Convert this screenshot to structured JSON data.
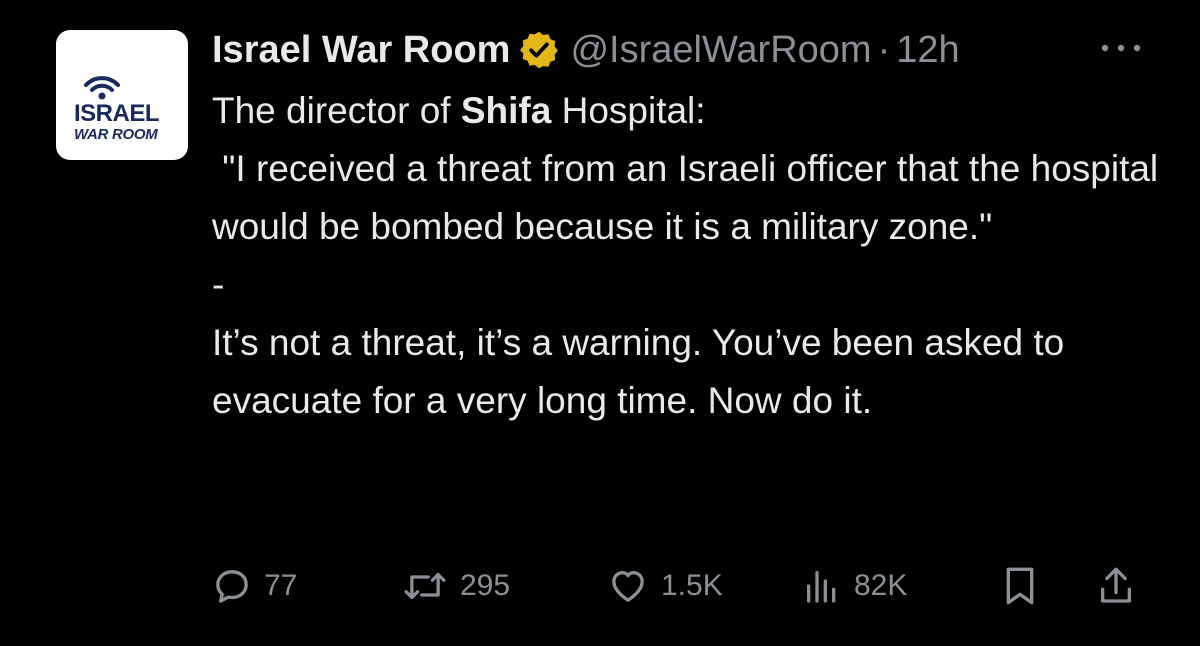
{
  "post": {
    "display_name": "Israel War Room",
    "handle": "@IsraelWarRoom",
    "separator": "·",
    "time": "12h",
    "avatar": {
      "line1": "ISRAEL",
      "line2": "WAR ROOM"
    },
    "body": {
      "line1_pre": "The director of ",
      "line1_bold": "Shifa",
      "line1_post": " Hospital:",
      "quote": " \"I received a threat from an Israeli officer that the hospital would be bombed because it is a military zone.\"",
      "dash": "-",
      "reply": "It’s not a threat, it’s a warning. You’ve been asked to evacuate for a very long time. Now do it."
    },
    "stats": {
      "replies": "77",
      "reposts": "295",
      "likes": "1.5K",
      "views": "82K"
    },
    "icons": {
      "verified": "verified-badge-icon",
      "more": "more-icon",
      "reply": "reply-icon",
      "repost": "repost-icon",
      "like": "heart-icon",
      "views": "views-icon",
      "bookmark": "bookmark-icon",
      "share": "share-icon"
    },
    "colors": {
      "background": "#000000",
      "text": "#e7e9ea",
      "muted": "#8b9096",
      "verified_gold": "#e2b719",
      "logo_navy": "#1a2a5e"
    }
  }
}
